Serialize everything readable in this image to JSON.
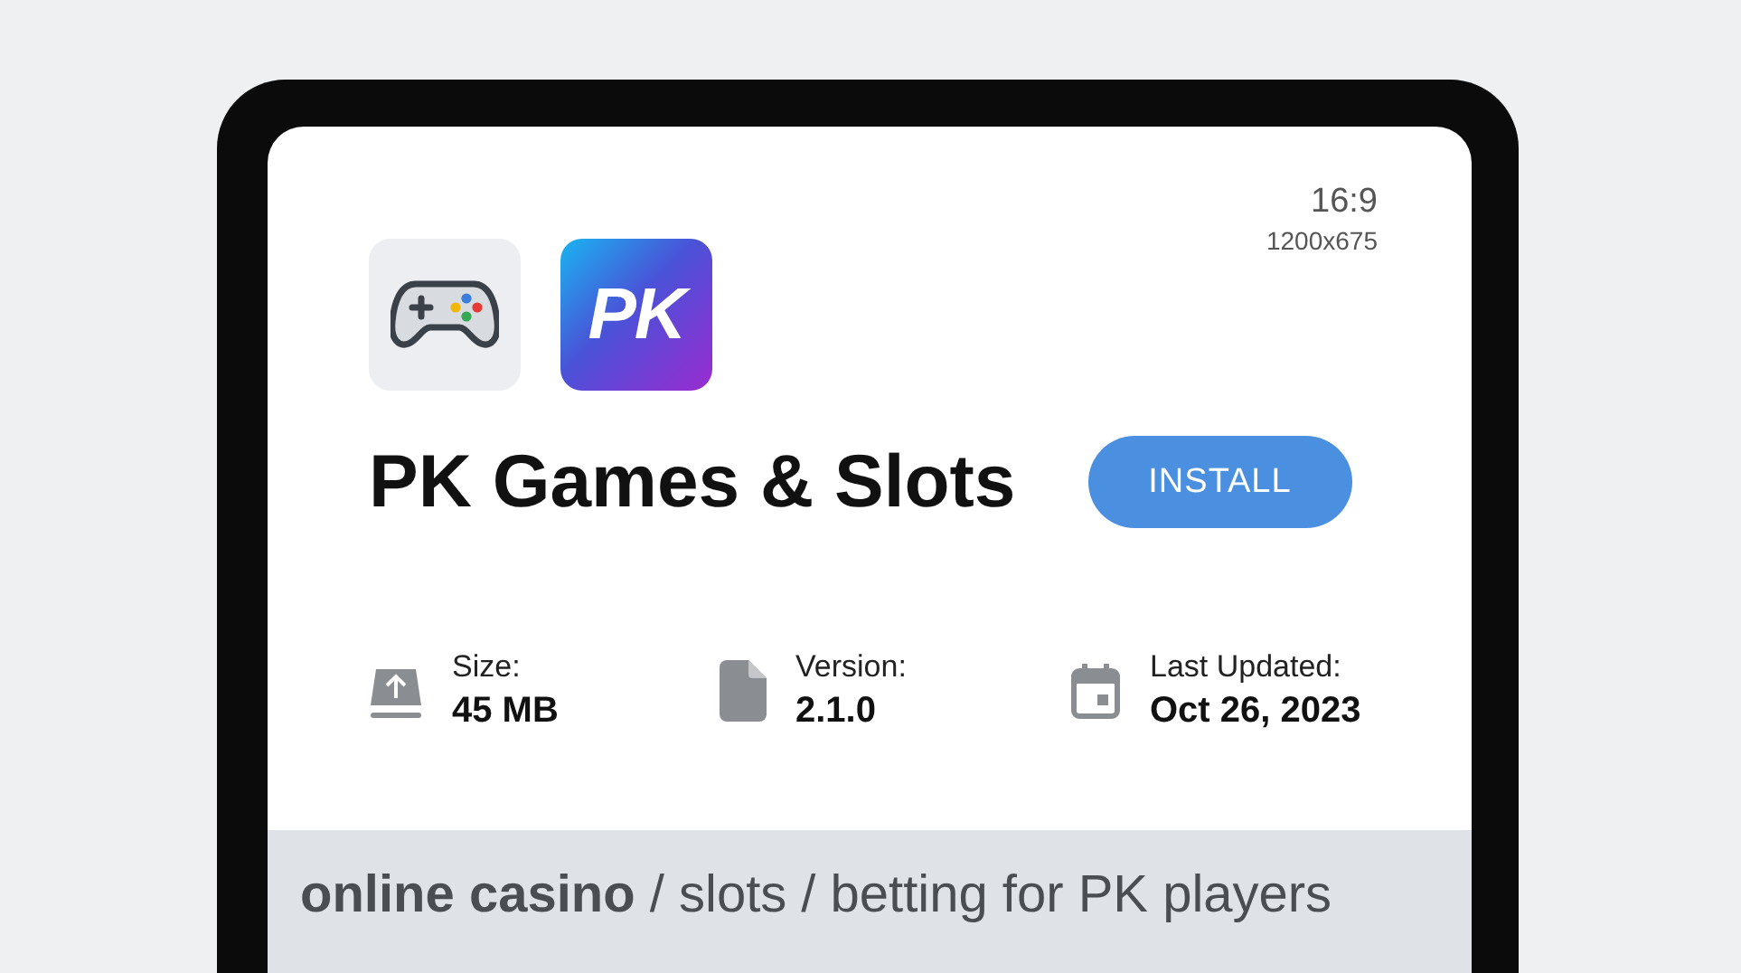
{
  "aspect_ratio": {
    "ratio": "16:9",
    "resolution": "1200x675"
  },
  "app": {
    "logo_text": "PK",
    "title": "PK Games & Slots",
    "install_button": "INSTALL"
  },
  "stats": [
    {
      "kind": "size",
      "label": "Size:",
      "value": "45 MB"
    },
    {
      "kind": "version",
      "label": "Version:",
      "value": "2.1.0"
    },
    {
      "kind": "updated",
      "label": "Last Updated:",
      "value": "Oct 26, 2023"
    }
  ],
  "tagline": "**online casino** / slots / betting for PK players"
}
